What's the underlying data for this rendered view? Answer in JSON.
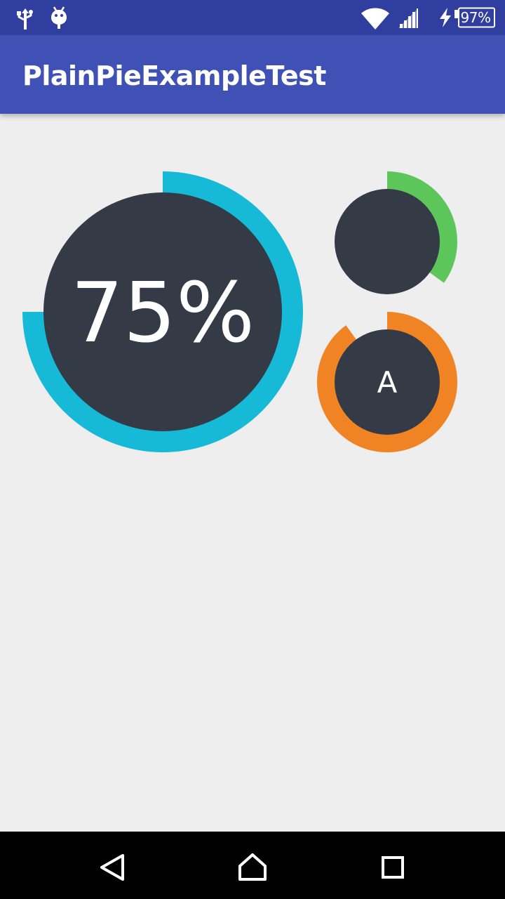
{
  "status_bar": {
    "left_icons": [
      "usb-icon",
      "android-debug-icon"
    ],
    "right_icons": [
      "wifi-icon",
      "signal-icon",
      "charging-icon",
      "battery-icon"
    ],
    "battery_text": "97%"
  },
  "app_bar": {
    "title": "PlainPieExampleTest",
    "color": "#3f51b5"
  },
  "pies": [
    {
      "name": "pie-large",
      "percentage": 0.75,
      "label": "75%",
      "ring_color": "#16b9d6",
      "inner_color": "#343a46"
    },
    {
      "name": "pie-small-green",
      "percentage": 0.35,
      "label": "",
      "ring_color": "#5cc65a",
      "inner_color": "#343a46"
    },
    {
      "name": "pie-small-orange",
      "percentage": 0.9,
      "label": "A",
      "ring_color": "#f08323",
      "inner_color": "#343a46"
    }
  ],
  "nav_bar": {
    "buttons": [
      "back-icon",
      "home-icon",
      "recents-icon"
    ]
  }
}
